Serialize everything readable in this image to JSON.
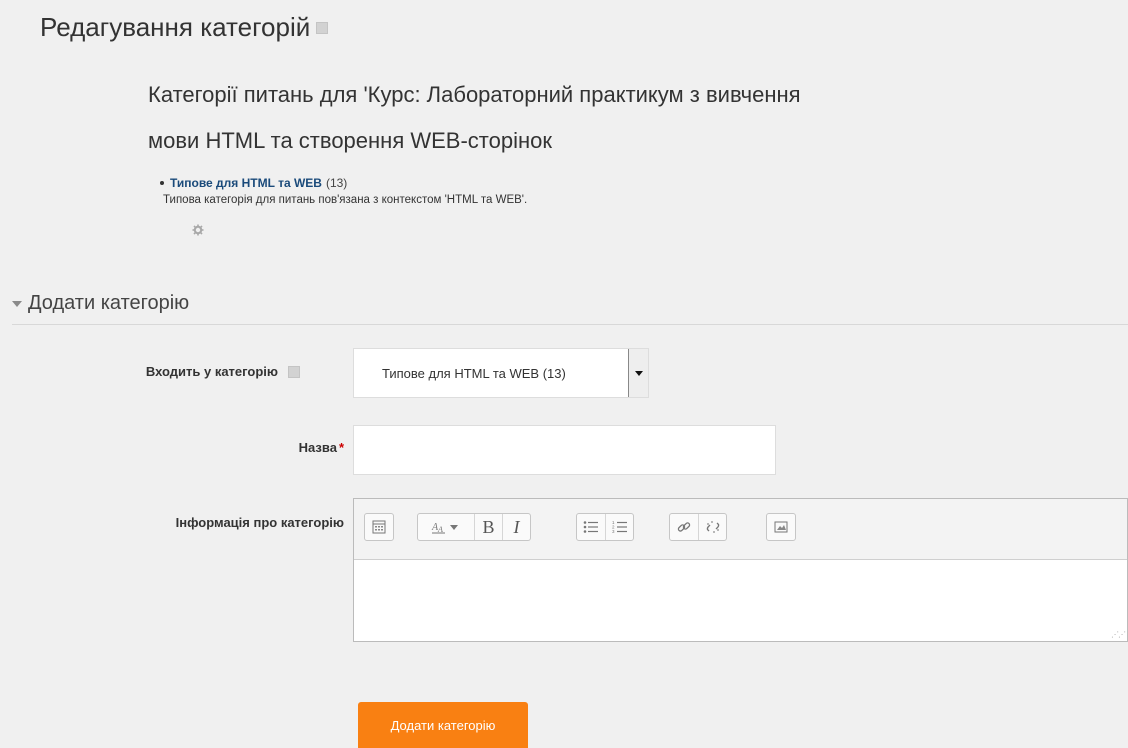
{
  "page": {
    "title": "Редагування категорій"
  },
  "categories": {
    "heading_line1": "Категорії питань для 'Курс: Лабораторний практикум з вивчення",
    "heading_line2": "мови HTML та створення WEB-сторінок",
    "items": [
      {
        "name": "Типове для HTML та WEB",
        "count": "(13)",
        "description": "Типова категорія для питань пов'язана з контекстом 'HTML та WEB'."
      }
    ]
  },
  "add_category": {
    "section_title": "Додати категорію",
    "parent_label": "Входить у категорію",
    "parent_value": "Типове для HTML та WEB (13)",
    "name_label": "Назва",
    "required_mark": "*",
    "name_value": "",
    "info_label": "Інформація про категорію",
    "submit_label": "Додати категорію"
  },
  "editor": {
    "toolbar_icons": [
      "toolbar-toggle-icon",
      "font-style-icon",
      "bold-icon",
      "italic-icon",
      "unordered-list-icon",
      "ordered-list-icon",
      "link-icon",
      "unlink-icon",
      "image-icon"
    ],
    "bold_glyph": "B",
    "italic_glyph": "I"
  },
  "colors": {
    "accent": "#f98012",
    "link": "#1a4a7a",
    "required": "#cc0000"
  }
}
